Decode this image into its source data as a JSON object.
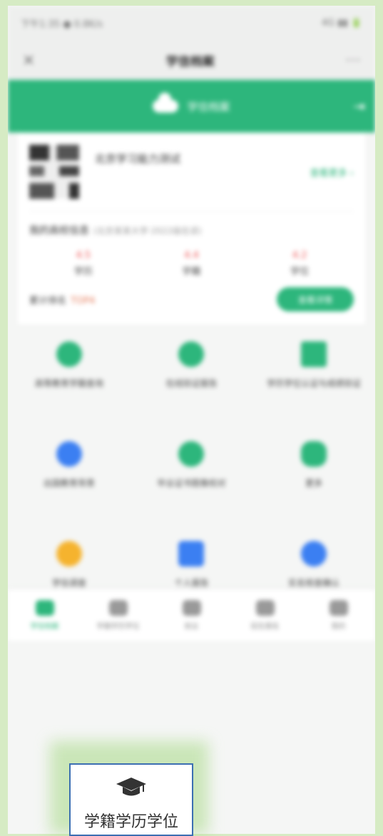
{
  "statusbar": {
    "left": "下午1:35 ● 0.8K/s",
    "right": "4G ▮▮ 🔋"
  },
  "titlebar": {
    "close": "×",
    "title": "学信档案",
    "more": "⋯"
  },
  "header": {
    "title": "学信档案",
    "exit": "⇥"
  },
  "profile": {
    "name": "北京学习能力测试",
    "link": "查看更多 ›"
  },
  "school": {
    "title": "我的高校信息",
    "subtitle": "(北京某某大学·2022级在读)",
    "stats": [
      {
        "value": "4.5",
        "label": "学历"
      },
      {
        "value": "4.4",
        "label": "学籍"
      },
      {
        "value": "4.2",
        "label": "学位"
      }
    ],
    "rank_label": "累计排名",
    "rank_value": "TOP4",
    "button": "查看详情"
  },
  "grid": [
    {
      "label": "高等教育学籍查询",
      "icon": "person-icon",
      "color": "#2db67c"
    },
    {
      "label": "在线验证报告",
      "icon": "shield-icon",
      "color": "#2db67c"
    },
    {
      "label": "学历学位认证与成绩验证",
      "icon": "card-icon",
      "color": "#2db67c"
    },
    {
      "label": "出国教育背景",
      "icon": "globe-icon",
      "color": "#3b7ff2"
    },
    {
      "label": "毕业证书图像校对",
      "icon": "user-check-icon",
      "color": "#2db67c"
    },
    {
      "label": "更多",
      "icon": "chat-icon",
      "color": "#2db67c"
    },
    {
      "label": "学信调查",
      "icon": "smile-icon",
      "color": "#f5b32e"
    },
    {
      "label": "个人报告",
      "icon": "clipboard-icon",
      "color": "#3b7ff2"
    },
    {
      "label": "实名核查确认",
      "icon": "badge-icon",
      "color": "#3b7ff2"
    }
  ],
  "tabs": [
    {
      "label": "学信档案",
      "icon": "home-icon"
    },
    {
      "label": "学籍学历学位",
      "icon": "graduation-cap-icon"
    },
    {
      "label": "就业",
      "icon": "briefcase-icon"
    },
    {
      "label": "招生报名",
      "icon": "building-icon"
    },
    {
      "label": "我的",
      "icon": "user-icon"
    }
  ],
  "tooltip": {
    "label": "学籍学历学位",
    "icon": "graduation-cap-icon"
  }
}
